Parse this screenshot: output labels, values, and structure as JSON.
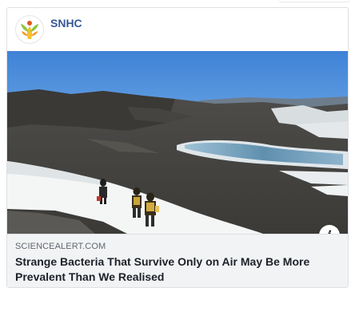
{
  "post": {
    "page_name": "SNHC",
    "avatar_icon": "snhc-logo-icon",
    "photo_subject": "antarctic-landscape-image",
    "info_button_label": "i",
    "link": {
      "domain": "SCIENCEALERT.COM",
      "headline": "Strange Bacteria That Survive Only on Air May Be More Prevalent Than We Realised"
    }
  },
  "colors": {
    "page_name": "#385898",
    "preview_background": "#f2f3f5",
    "domain_text": "#606770",
    "headline_text": "#1d2129"
  }
}
